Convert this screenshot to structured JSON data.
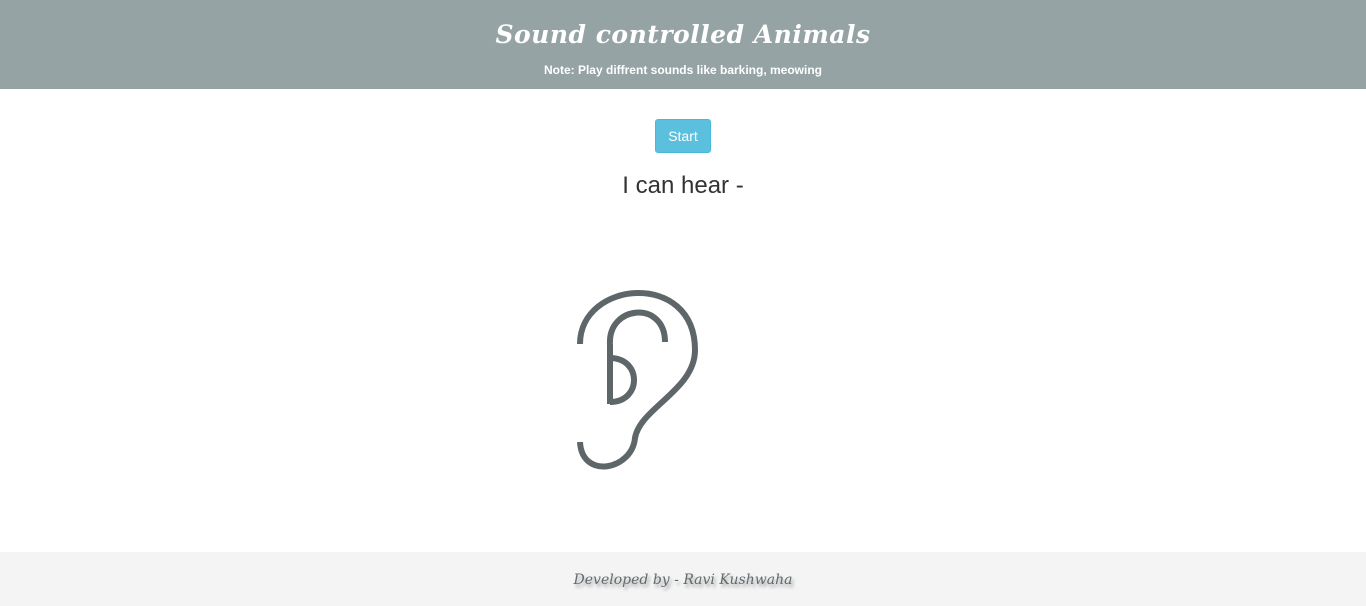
{
  "header": {
    "title": "Sound controlled Animals",
    "note": "Note: Play diffrent sounds like barking, meowing",
    "background": "#95a3a4"
  },
  "controls": {
    "start_label": "Start",
    "button_color": "#5bc0de"
  },
  "status": {
    "hear_text": "I can hear -"
  },
  "illustration": {
    "icon": "ear-icon",
    "stroke_color": "#5f6669"
  },
  "footer": {
    "credit": "Developed by - Ravi Kushwaha"
  }
}
